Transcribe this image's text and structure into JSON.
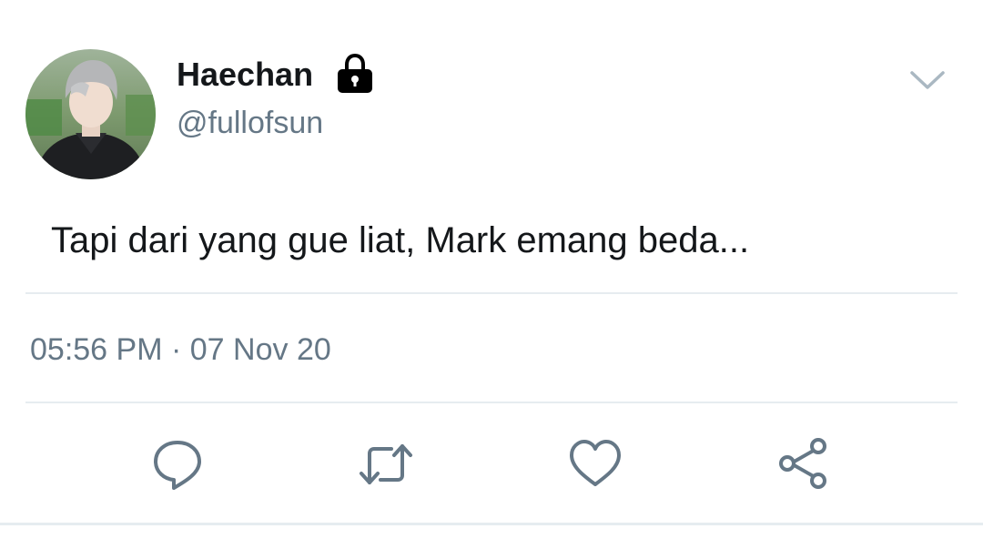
{
  "user": {
    "display_name": "Haechan",
    "handle": "@fullofsun",
    "protected_icon": "lock-icon",
    "avatar": "profile-photo"
  },
  "tweet": {
    "text": "Tapi dari yang gue liat, Mark emang beda...",
    "time": "05:56 PM",
    "separator": "·",
    "date": "07 Nov 20"
  },
  "actions": {
    "reply_icon": "reply-icon",
    "retweet_icon": "retweet-icon",
    "like_icon": "heart-icon",
    "share_icon": "share-icon",
    "more_icon": "chevron-down-icon"
  },
  "colors": {
    "text": "#14171a",
    "secondary": "#657786",
    "divider": "#e6ecf0"
  }
}
